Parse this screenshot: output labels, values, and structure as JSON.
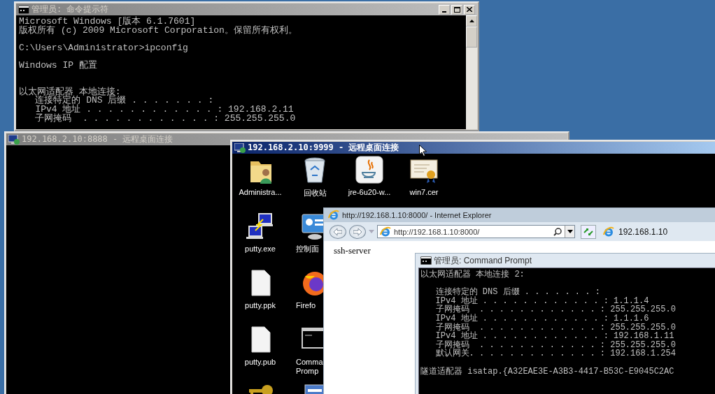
{
  "cmd_window": {
    "title": "管理员: 命令提示符",
    "active": false,
    "blocks": [
      [
        "Microsoft Windows [版本 6.1.7601]",
        "版权所有 (c) 2009 Microsoft Corporation。保留所有权利。"
      ],
      [
        "C:\\Users\\Administrator>ipconfig"
      ],
      [
        "Windows IP 配置"
      ],
      [
        "以太网适配器 本地连接:",
        "   连接特定的 DNS 后缀 . . . . . . . :",
        "   IPv4 地址 . . . . . . . . . . . . : 192.168.2.11",
        "   子网掩码  . . . . . . . . . . . . : 255.255.255.0"
      ]
    ]
  },
  "remote_window_1": {
    "title": "192.168.2.10:8888 - 远程桌面连接",
    "active": false
  },
  "remote_window_2": {
    "title": "192.168.2.10:9999 - 远程桌面连接",
    "active": true,
    "desktop_icons": [
      {
        "kind": "user-folder",
        "label": "Administra..."
      },
      {
        "kind": "recycle-bin",
        "label": "回收站"
      },
      {
        "kind": "java",
        "label": "jre-6u20-w..."
      },
      {
        "kind": "certificate",
        "label": "win7.cer"
      },
      {
        "kind": "putty",
        "label": "putty.exe"
      },
      {
        "kind": "control-panel",
        "label": "控制面"
      },
      {
        "kind": "file",
        "label": "putty.ppk"
      },
      {
        "kind": "firefox",
        "label": "Firefo"
      },
      {
        "kind": "file",
        "label": "putty.pub"
      },
      {
        "kind": "cmd",
        "label": "Comma Promp"
      },
      {
        "kind": "key"
      },
      {
        "kind": "app"
      }
    ]
  },
  "browser_window": {
    "title": "http://192.168.1.10:8000/ - Internet Explorer",
    "address": "http://192.168.1.10:8000/",
    "tab": "192.168.1.10",
    "page_heading": "ssh-server"
  },
  "embedded_console": {
    "title": "管理员: Command Prompt",
    "blocks": [
      [
        "以太网适配器 本地连接 2:"
      ],
      [
        "   连接特定的 DNS 后缀 . . . . . . . :",
        "   IPv4 地址 . . . . . . . . . . . . : 1.1.1.4",
        "   子网掩码  . . . . . . . . . . . . : 255.255.255.0",
        "   IPv4 地址 . . . . . . . . . . . . : 1.1.1.6",
        "   子网掩码  . . . . . . . . . . . . : 255.255.255.0",
        "   IPv4 地址 . . . . . . . . . . . . : 192.168.1.11",
        "   子网掩码  . . . . . . . . . . . . : 255.255.255.0",
        "   默认网关. . . . . . . . . . . . . : 192.168.1.254"
      ],
      [
        "隧道适配器 isatap.{A32EAE3E-A3B3-4417-B53C-E9045C2AC"
      ]
    ]
  }
}
